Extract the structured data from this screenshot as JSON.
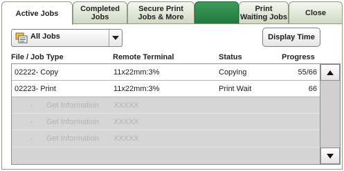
{
  "tabs": [
    {
      "label": "Active Jobs",
      "active": true
    },
    {
      "label": "Completed\nJobs",
      "active": false
    },
    {
      "label": "Secure Print\nJobs & More",
      "active": false
    },
    {
      "label": "",
      "active": false
    },
    {
      "label": "Print\nWaiting Jobs",
      "active": false
    },
    {
      "label": "Close",
      "active": false
    }
  ],
  "filter": {
    "selected": "All Jobs",
    "icon": "jobs-list-icon"
  },
  "display_time_label": "Display Time",
  "columns": {
    "file_job_type": "File / Job Type",
    "remote_terminal": "Remote Terminal",
    "status": "Status",
    "progress": "Progress"
  },
  "jobs": [
    {
      "file_job_type": "02222- Copy",
      "remote_terminal": "11x22mm:3%",
      "status": "Copying",
      "progress": "55/66"
    },
    {
      "file_job_type": "02223- Print",
      "remote_terminal": "11x22mm:3%",
      "status": "Print Wait",
      "progress": "66"
    }
  ],
  "placeholder_rows": [
    {
      "prefix": "-",
      "info": "Get Information",
      "terminal": "XXXXX"
    },
    {
      "prefix": "-",
      "info": "Get Information",
      "terminal": "XXXXX"
    },
    {
      "prefix": "-",
      "info": "Get Information",
      "terminal": "XXXXX"
    }
  ],
  "scroll": {
    "up_icon": "scroll-up-icon",
    "down_icon": "scroll-down-icon"
  },
  "colors": {
    "tab_green": "#2b8a47",
    "panel_border": "#8c9a82"
  }
}
